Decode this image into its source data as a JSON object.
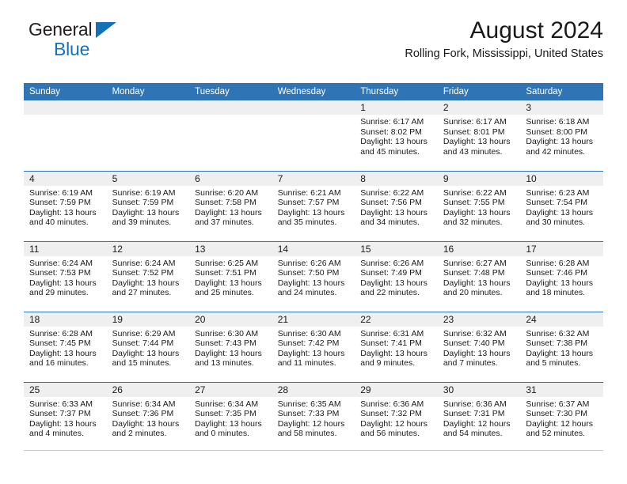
{
  "brand": {
    "line1": "General",
    "line2": "Blue",
    "triangle_color": "#1272b8"
  },
  "header": {
    "title": "August 2024",
    "location": "Rolling Fork, Mississippi, United States"
  },
  "colors": {
    "header_blue": "#2f75b5",
    "daynum_band": "#efefef",
    "text": "#1a1a1a"
  },
  "calendar": {
    "weekday_headers": [
      "Sunday",
      "Monday",
      "Tuesday",
      "Wednesday",
      "Thursday",
      "Friday",
      "Saturday"
    ],
    "weeks": [
      [
        {
          "empty": true
        },
        {
          "empty": true
        },
        {
          "empty": true
        },
        {
          "empty": true
        },
        {
          "day": "1",
          "sunrise": "Sunrise: 6:17 AM",
          "sunset": "Sunset: 8:02 PM",
          "daylight1": "Daylight: 13 hours",
          "daylight2": "and 45 minutes."
        },
        {
          "day": "2",
          "sunrise": "Sunrise: 6:17 AM",
          "sunset": "Sunset: 8:01 PM",
          "daylight1": "Daylight: 13 hours",
          "daylight2": "and 43 minutes."
        },
        {
          "day": "3",
          "sunrise": "Sunrise: 6:18 AM",
          "sunset": "Sunset: 8:00 PM",
          "daylight1": "Daylight: 13 hours",
          "daylight2": "and 42 minutes."
        }
      ],
      [
        {
          "day": "4",
          "sunrise": "Sunrise: 6:19 AM",
          "sunset": "Sunset: 7:59 PM",
          "daylight1": "Daylight: 13 hours",
          "daylight2": "and 40 minutes."
        },
        {
          "day": "5",
          "sunrise": "Sunrise: 6:19 AM",
          "sunset": "Sunset: 7:59 PM",
          "daylight1": "Daylight: 13 hours",
          "daylight2": "and 39 minutes."
        },
        {
          "day": "6",
          "sunrise": "Sunrise: 6:20 AM",
          "sunset": "Sunset: 7:58 PM",
          "daylight1": "Daylight: 13 hours",
          "daylight2": "and 37 minutes."
        },
        {
          "day": "7",
          "sunrise": "Sunrise: 6:21 AM",
          "sunset": "Sunset: 7:57 PM",
          "daylight1": "Daylight: 13 hours",
          "daylight2": "and 35 minutes."
        },
        {
          "day": "8",
          "sunrise": "Sunrise: 6:22 AM",
          "sunset": "Sunset: 7:56 PM",
          "daylight1": "Daylight: 13 hours",
          "daylight2": "and 34 minutes."
        },
        {
          "day": "9",
          "sunrise": "Sunrise: 6:22 AM",
          "sunset": "Sunset: 7:55 PM",
          "daylight1": "Daylight: 13 hours",
          "daylight2": "and 32 minutes."
        },
        {
          "day": "10",
          "sunrise": "Sunrise: 6:23 AM",
          "sunset": "Sunset: 7:54 PM",
          "daylight1": "Daylight: 13 hours",
          "daylight2": "and 30 minutes."
        }
      ],
      [
        {
          "day": "11",
          "sunrise": "Sunrise: 6:24 AM",
          "sunset": "Sunset: 7:53 PM",
          "daylight1": "Daylight: 13 hours",
          "daylight2": "and 29 minutes."
        },
        {
          "day": "12",
          "sunrise": "Sunrise: 6:24 AM",
          "sunset": "Sunset: 7:52 PM",
          "daylight1": "Daylight: 13 hours",
          "daylight2": "and 27 minutes."
        },
        {
          "day": "13",
          "sunrise": "Sunrise: 6:25 AM",
          "sunset": "Sunset: 7:51 PM",
          "daylight1": "Daylight: 13 hours",
          "daylight2": "and 25 minutes."
        },
        {
          "day": "14",
          "sunrise": "Sunrise: 6:26 AM",
          "sunset": "Sunset: 7:50 PM",
          "daylight1": "Daylight: 13 hours",
          "daylight2": "and 24 minutes."
        },
        {
          "day": "15",
          "sunrise": "Sunrise: 6:26 AM",
          "sunset": "Sunset: 7:49 PM",
          "daylight1": "Daylight: 13 hours",
          "daylight2": "and 22 minutes."
        },
        {
          "day": "16",
          "sunrise": "Sunrise: 6:27 AM",
          "sunset": "Sunset: 7:48 PM",
          "daylight1": "Daylight: 13 hours",
          "daylight2": "and 20 minutes."
        },
        {
          "day": "17",
          "sunrise": "Sunrise: 6:28 AM",
          "sunset": "Sunset: 7:46 PM",
          "daylight1": "Daylight: 13 hours",
          "daylight2": "and 18 minutes."
        }
      ],
      [
        {
          "day": "18",
          "sunrise": "Sunrise: 6:28 AM",
          "sunset": "Sunset: 7:45 PM",
          "daylight1": "Daylight: 13 hours",
          "daylight2": "and 16 minutes."
        },
        {
          "day": "19",
          "sunrise": "Sunrise: 6:29 AM",
          "sunset": "Sunset: 7:44 PM",
          "daylight1": "Daylight: 13 hours",
          "daylight2": "and 15 minutes."
        },
        {
          "day": "20",
          "sunrise": "Sunrise: 6:30 AM",
          "sunset": "Sunset: 7:43 PM",
          "daylight1": "Daylight: 13 hours",
          "daylight2": "and 13 minutes."
        },
        {
          "day": "21",
          "sunrise": "Sunrise: 6:30 AM",
          "sunset": "Sunset: 7:42 PM",
          "daylight1": "Daylight: 13 hours",
          "daylight2": "and 11 minutes."
        },
        {
          "day": "22",
          "sunrise": "Sunrise: 6:31 AM",
          "sunset": "Sunset: 7:41 PM",
          "daylight1": "Daylight: 13 hours",
          "daylight2": "and 9 minutes."
        },
        {
          "day": "23",
          "sunrise": "Sunrise: 6:32 AM",
          "sunset": "Sunset: 7:40 PM",
          "daylight1": "Daylight: 13 hours",
          "daylight2": "and 7 minutes."
        },
        {
          "day": "24",
          "sunrise": "Sunrise: 6:32 AM",
          "sunset": "Sunset: 7:38 PM",
          "daylight1": "Daylight: 13 hours",
          "daylight2": "and 5 minutes."
        }
      ],
      [
        {
          "day": "25",
          "sunrise": "Sunrise: 6:33 AM",
          "sunset": "Sunset: 7:37 PM",
          "daylight1": "Daylight: 13 hours",
          "daylight2": "and 4 minutes."
        },
        {
          "day": "26",
          "sunrise": "Sunrise: 6:34 AM",
          "sunset": "Sunset: 7:36 PM",
          "daylight1": "Daylight: 13 hours",
          "daylight2": "and 2 minutes."
        },
        {
          "day": "27",
          "sunrise": "Sunrise: 6:34 AM",
          "sunset": "Sunset: 7:35 PM",
          "daylight1": "Daylight: 13 hours",
          "daylight2": "and 0 minutes."
        },
        {
          "day": "28",
          "sunrise": "Sunrise: 6:35 AM",
          "sunset": "Sunset: 7:33 PM",
          "daylight1": "Daylight: 12 hours",
          "daylight2": "and 58 minutes."
        },
        {
          "day": "29",
          "sunrise": "Sunrise: 6:36 AM",
          "sunset": "Sunset: 7:32 PM",
          "daylight1": "Daylight: 12 hours",
          "daylight2": "and 56 minutes."
        },
        {
          "day": "30",
          "sunrise": "Sunrise: 6:36 AM",
          "sunset": "Sunset: 7:31 PM",
          "daylight1": "Daylight: 12 hours",
          "daylight2": "and 54 minutes."
        },
        {
          "day": "31",
          "sunrise": "Sunrise: 6:37 AM",
          "sunset": "Sunset: 7:30 PM",
          "daylight1": "Daylight: 12 hours",
          "daylight2": "and 52 minutes."
        }
      ]
    ]
  }
}
